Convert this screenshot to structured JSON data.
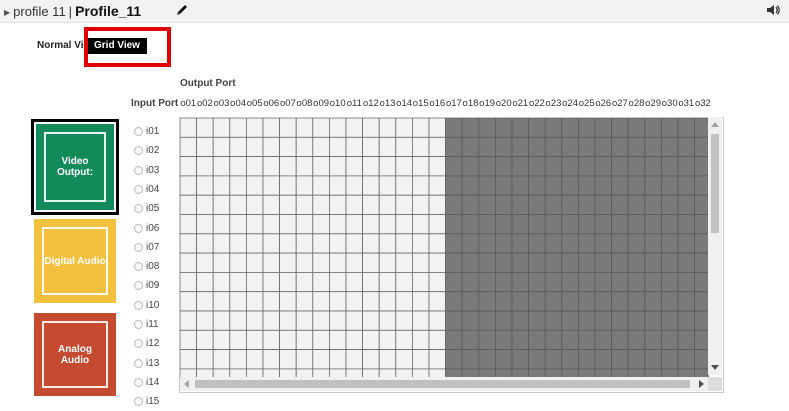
{
  "header": {
    "breadcrumb_text": "profile 11",
    "separator": "|",
    "profile_name": "Profile_11",
    "icons": {
      "expand": "triangle-right-icon",
      "edit": "pencil-icon",
      "sound": "speaker-icon"
    }
  },
  "view_toggle": {
    "normal": "Normal View",
    "grid": "Grid View",
    "selected": "Grid View"
  },
  "labels": {
    "output_port": "Output Port",
    "input_port": "Input Port"
  },
  "output_ports": [
    "o01",
    "o02",
    "o03",
    "o04",
    "o05",
    "o06",
    "o07",
    "o08",
    "o09",
    "o10",
    "o11",
    "o12",
    "o13",
    "o14",
    "o15",
    "o16",
    "o17",
    "o18",
    "o19",
    "o20",
    "o21",
    "o22",
    "o23",
    "o24",
    "o25",
    "o26",
    "o27",
    "o28",
    "o29",
    "o30",
    "o31",
    "o32"
  ],
  "input_ports": [
    "i01",
    "i02",
    "i03",
    "i04",
    "i05",
    "i06",
    "i07",
    "i08",
    "i09",
    "i10",
    "i11",
    "i12",
    "i13",
    "i14",
    "i15"
  ],
  "outputs_enabled_count": 16,
  "tiles": [
    {
      "label": "Video Output:",
      "color": "#138a5a",
      "selected": true
    },
    {
      "label": "Digital Audio",
      "color": "#f3c040",
      "selected": false
    },
    {
      "label": "Analog Audio",
      "color": "#c44a30",
      "selected": false
    }
  ],
  "colors": {
    "grid_enabled": "#f2f2f2",
    "grid_disabled": "#7a7a7a",
    "highlight": "#e00000"
  }
}
